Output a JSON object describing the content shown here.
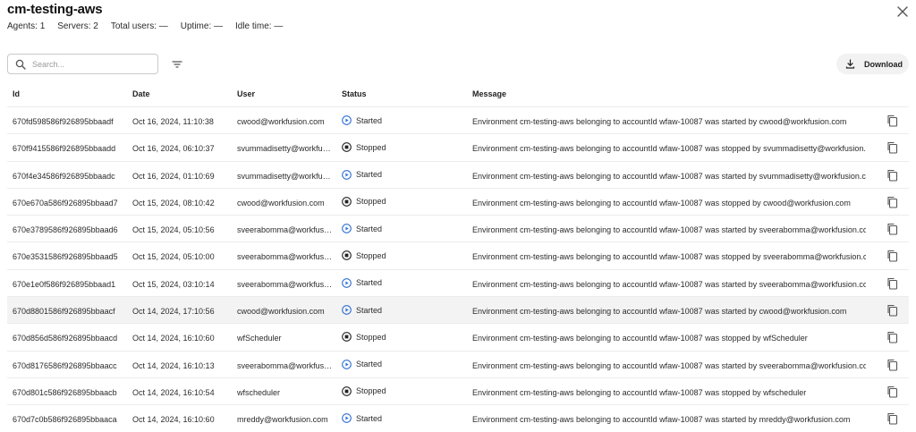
{
  "header": {
    "title": "cm-testing-aws",
    "stats": [
      "Agents: 1",
      "Servers: 2",
      "Total users: —",
      "Uptime: —",
      "Idle time: —"
    ]
  },
  "toolbar": {
    "search_placeholder": "Search...",
    "download_label": "Download"
  },
  "table": {
    "columns": {
      "id": "Id",
      "date": "Date",
      "user": "User",
      "status": "Status",
      "message": "Message"
    },
    "rows": [
      {
        "id": "670fd598586f926895bbaadf",
        "date": "Oct 16, 2024, 11:10:38",
        "user": "cwood@workfusion.com",
        "status": "Started",
        "message": "Environment cm-testing-aws belonging to accountId wfaw-10087 was started by cwood@workfusion.com"
      },
      {
        "id": "670f9415586f926895bbaadd",
        "date": "Oct 16, 2024, 06:10:37",
        "user": "svummadisetty@workfusi...",
        "status": "Stopped",
        "message": "Environment cm-testing-aws belonging to accountId wfaw-10087 was stopped by svummadisetty@workfusion.com"
      },
      {
        "id": "670f4e34586f926895bbaadc",
        "date": "Oct 16, 2024, 01:10:69",
        "user": "svummadisetty@workfusi...",
        "status": "Started",
        "message": "Environment cm-testing-aws belonging to accountId wfaw-10087 was started by svummadisetty@workfusion.com"
      },
      {
        "id": "670e670a586f926895bbaad7",
        "date": "Oct 15, 2024, 08:10:42",
        "user": "cwood@workfusion.com",
        "status": "Stopped",
        "message": "Environment cm-testing-aws belonging to accountId wfaw-10087 was stopped by cwood@workfusion.com"
      },
      {
        "id": "670e3789586f926895bbaad6",
        "date": "Oct 15, 2024, 05:10:56",
        "user": "sveerabomma@workfusio...",
        "status": "Started",
        "message": "Environment cm-testing-aws belonging to accountId wfaw-10087 was started by sveerabomma@workfusion.com"
      },
      {
        "id": "670e3531586f926895bbaad5",
        "date": "Oct 15, 2024, 05:10:00",
        "user": "sveerabomma@workfusio...",
        "status": "Stopped",
        "message": "Environment cm-testing-aws belonging to accountId wfaw-10087 was stopped by sveerabomma@workfusion.com"
      },
      {
        "id": "670e1e0f586f926895bbaad1",
        "date": "Oct 15, 2024, 03:10:14",
        "user": "sveerabomma@workfusio...",
        "status": "Started",
        "message": "Environment cm-testing-aws belonging to accountId wfaw-10087 was started by sveerabomma@workfusion.com"
      },
      {
        "id": "670d8801586f926895bbaacf",
        "date": "Oct 14, 2024, 17:10:56",
        "user": "cwood@workfusion.com",
        "status": "Started",
        "message": "Environment cm-testing-aws belonging to accountId wfaw-10087 was started by cwood@workfusion.com"
      },
      {
        "id": "670d856d586f926895bbaacd",
        "date": "Oct 14, 2024, 16:10:60",
        "user": "wfScheduler",
        "status": "Stopped",
        "message": "Environment cm-testing-aws belonging to accountId wfaw-10087 was stopped by wfScheduler"
      },
      {
        "id": "670d8176586f926895bbaacc",
        "date": "Oct 14, 2024, 16:10:13",
        "user": "sveerabomma@workfusio...",
        "status": "Started",
        "message": "Environment cm-testing-aws belonging to accountId wfaw-10087 was started by sveerabomma@workfusion.com"
      },
      {
        "id": "670d801c586f926895bbaacb",
        "date": "Oct 14, 2024, 16:10:54",
        "user": "wfscheduler",
        "status": "Stopped",
        "message": "Environment cm-testing-aws belonging to accountId wfaw-10087 was stopped by wfscheduler"
      },
      {
        "id": "670d7c0b586f926895bbaaca",
        "date": "Oct 14, 2024, 16:10:60",
        "user": "mreddy@workfusion.com",
        "status": "Started",
        "message": "Environment cm-testing-aws belonging to accountId wfaw-10087 was started by mreddy@workfusion.com"
      }
    ],
    "highlighted_row": 7
  },
  "icons": {
    "close": "close-icon",
    "search": "search-icon",
    "filter": "filter-icon",
    "download": "download-icon",
    "started": "play-circle-icon",
    "stopped": "stop-circle-icon",
    "copy": "copy-icon"
  },
  "colors": {
    "started_icon": "#2f6fd6",
    "stopped_icon": "#222222",
    "highlight_row": "#f3f3f3"
  }
}
